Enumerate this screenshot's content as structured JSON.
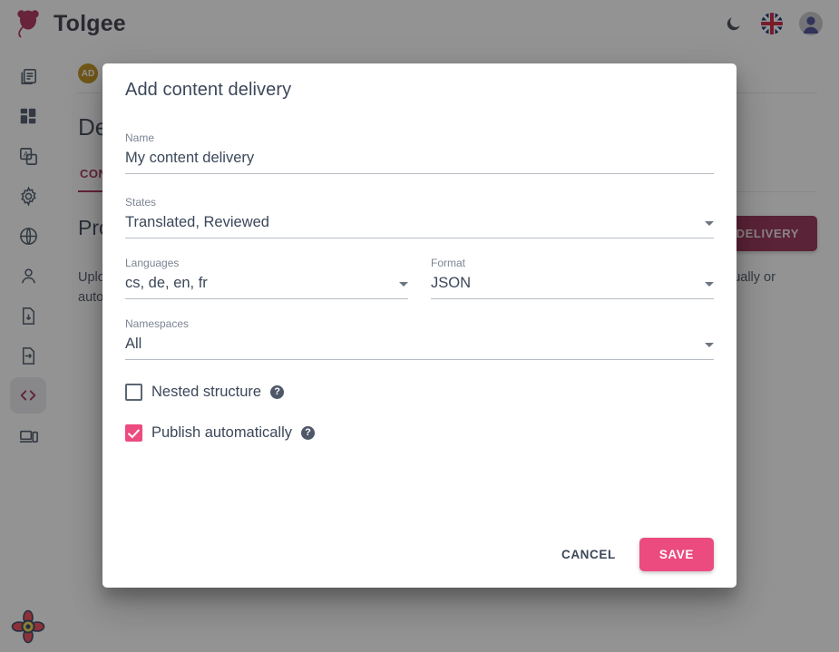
{
  "topbar": {
    "brand_name": "Tolgee",
    "logo_icon": "tolgee-mouse-logo",
    "dark_mode_icon": "moon-icon",
    "language_flag": "uk-flag-icon",
    "avatar_icon": "user-avatar"
  },
  "sidebar": {
    "items": [
      {
        "icon": "projects-list-icon",
        "name": "sidebar-item-projects",
        "active": false
      },
      {
        "icon": "dashboard-icon",
        "name": "sidebar-item-dashboard",
        "active": false
      },
      {
        "icon": "translations-icon",
        "name": "sidebar-item-translations",
        "active": false
      },
      {
        "icon": "settings-gear-icon",
        "name": "sidebar-item-settings",
        "active": false
      },
      {
        "icon": "globe-languages-icon",
        "name": "sidebar-item-languages",
        "active": false
      },
      {
        "icon": "members-person-icon",
        "name": "sidebar-item-members",
        "active": false
      },
      {
        "icon": "export-file-icon",
        "name": "sidebar-item-export",
        "active": false
      },
      {
        "icon": "import-file-icon",
        "name": "sidebar-item-import",
        "active": false
      },
      {
        "icon": "code-brackets-icon",
        "name": "sidebar-item-developer",
        "active": true
      },
      {
        "icon": "integrate-devices-icon",
        "name": "sidebar-item-integrate",
        "active": false
      }
    ],
    "bottom_logo_icon": "flower-atom-logo"
  },
  "breadcrumb": {
    "avatar_initials": "AD",
    "badge": "",
    "items": [
      "",
      "",
      "",
      ""
    ]
  },
  "page": {
    "title": "Developer",
    "tabs": [
      {
        "label": "CONTENT DELIVERY",
        "active": true
      }
    ],
    "section_title": "Production",
    "add_button_label": "ADD CONTENT DELIVERY",
    "description": "Upload your data to a CDN so they can be used directly by your application. Publish action can be triggered manually or automatically."
  },
  "dialog": {
    "title": "Add content delivery",
    "fields": {
      "name": {
        "label": "Name",
        "value": "My content delivery"
      },
      "states": {
        "label": "States",
        "value": "Translated, Reviewed"
      },
      "languages": {
        "label": "Languages",
        "value": "cs, de, en, fr"
      },
      "format": {
        "label": "Format",
        "value": "JSON"
      },
      "namespaces": {
        "label": "Namespaces",
        "value": "All"
      }
    },
    "checkboxes": [
      {
        "label": "Nested structure",
        "checked": false,
        "help_icon": "help-question-icon"
      },
      {
        "label": "Publish automatically",
        "checked": true,
        "help_icon": "help-question-icon"
      }
    ],
    "cancel_label": "CANCEL",
    "save_label": "SAVE"
  },
  "colors": {
    "accent_pink": "#ec4b7f",
    "brand_dark_pink": "#9d1f4f",
    "button_dark": "#8e1f47",
    "text_primary": "#3b4759",
    "text_muted": "#7b8494"
  }
}
